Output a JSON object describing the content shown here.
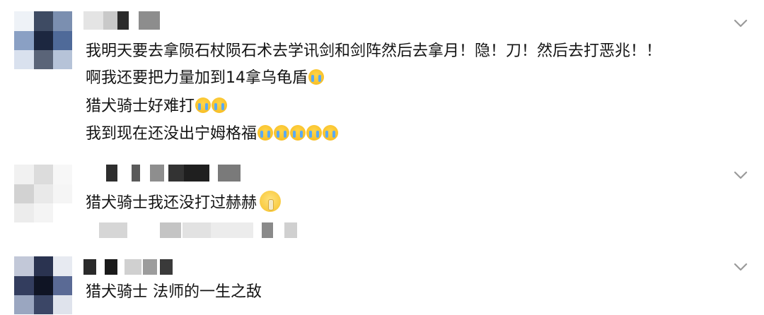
{
  "comments": [
    {
      "lines": [
        "我明天要去拿陨石杖陨石术去学讯剑和剑阵然后去拿月！隐！刀！然后去打恶兆！！",
        "啊我还要把力量加到14拿乌龟盾",
        "猎犬骑士好难打",
        "我到现在还没出宁姆格福"
      ],
      "emoji_counts": [
        0,
        1,
        2,
        5
      ],
      "emoji_icon": "loudly-crying-emoji",
      "expand_icon": "chevron-down-icon"
    },
    {
      "lines": [
        "猎犬骑士我还没打过赫赫"
      ],
      "emoji_icon": "shushing-face-emoji",
      "expand_icon": "chevron-down-icon"
    },
    {
      "lines": [
        "猎犬骑士 法师的一生之敌"
      ],
      "expand_icon": "chevron-down-icon"
    }
  ],
  "colors": {
    "text": "#141414",
    "chevron": "#9a9a9a",
    "background": "#ffffff"
  }
}
